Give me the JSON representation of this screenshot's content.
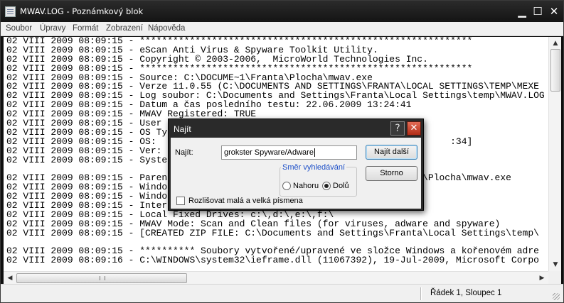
{
  "window": {
    "title": "MWAV.LOG - Poznámkový blok",
    "minimize_glyph": "▁",
    "maximize_glyph": "☐",
    "close_glyph": "✕"
  },
  "menu": [
    "Soubor",
    "Úpravy",
    "Formát",
    "Zobrazení",
    "Nápověda"
  ],
  "editor": {
    "lines": [
      "02 VIII 2009 08:09:15 - ************************************************************",
      "02 VIII 2009 08:09:15 - eScan Anti Virus & Spyware Toolkit Utility.",
      "02 VIII 2009 08:09:15 - Copyright © 2003-2006,  MicroWorld Technologies Inc.",
      "02 VIII 2009 08:09:15 - ************************************************************",
      "02 VIII 2009 08:09:15 - Source: C:\\DOCUME~1\\Franta\\Plocha\\mwav.exe",
      "02 VIII 2009 08:09:15 - Verze 11.0.55 (C:\\DOCUMENTS AND SETTINGS\\FRANTA\\LOCAL SETTINGS\\TEMP\\MEXE",
      "02 VIII 2009 08:09:15 - Log soubor: C:\\Documents and Settings\\Franta\\Local Settings\\temp\\MWAV.LOG",
      "02 VIII 2009 08:09:15 - Datum a čas posledního testu: 22.06.2009 13:24:41",
      "02 VIII 2009 08:09:15 - MWAV Registered: TRUE",
      "02 VIII 2009 08:09:15 - User",
      "02 VIII 2009 08:09:15 - OS Ty",
      "02 VIII 2009 08:09:15 - OS:                                                     :34]",
      "02 VIII 2009 08:09:15 - Ver:",
      "02 VIII 2009 08:09:15 - Syste",
      "",
      "02 VIII 2009 08:09:15 - Paren                                          anta\\Plocha\\mwav.exe",
      "02 VIII 2009 08:09:15 - Windo",
      "02 VIII 2009 08:09:15 - Windo",
      "02 VIII 2009 08:09:15 - Inter                                            00",
      "02 VIII 2009 08:09:15 - Local Fixed Drives: c:\\,d:\\,e:\\,f:\\",
      "02 VIII 2009 08:09:15 - MWAV Mode: Scan and Clean files (for viruses, adware and spyware)",
      "02 VIII 2009 08:09:15 - [CREATED ZIP FILE: C:\\Documents and Settings\\Franta\\Local Settings\\temp\\",
      "",
      "02 VIII 2009 08:09:15 - ********** Soubory vytvořené/upravené ve složce Windows a kořenovém adre",
      "02 VIII 2009 08:09:16 - C:\\WINDOWS\\system32\\ieframe.dll (11067392), 19-Jul-2009, Microsoft Corpo"
    ]
  },
  "scrollbars": {
    "up_glyph": "▲",
    "down_glyph": "▼",
    "left_glyph": "◀",
    "right_glyph": "▶"
  },
  "status": {
    "position": "Řádek 1, Sloupec 1"
  },
  "find_dialog": {
    "title": "Najít",
    "help_glyph": "?",
    "close_glyph": "✕",
    "find_label": "Najít:",
    "find_value": "grokster Spyware/Adware",
    "find_next_label": "Najít další",
    "cancel_label": "Storno",
    "direction_legend": "Směr vyhledávání",
    "direction_up_label": "Nahoru",
    "direction_down_label": "Dolů",
    "direction_selected": "down",
    "match_case_label": "Rozlišovat malá a velká písmena",
    "match_case_checked": false
  }
}
